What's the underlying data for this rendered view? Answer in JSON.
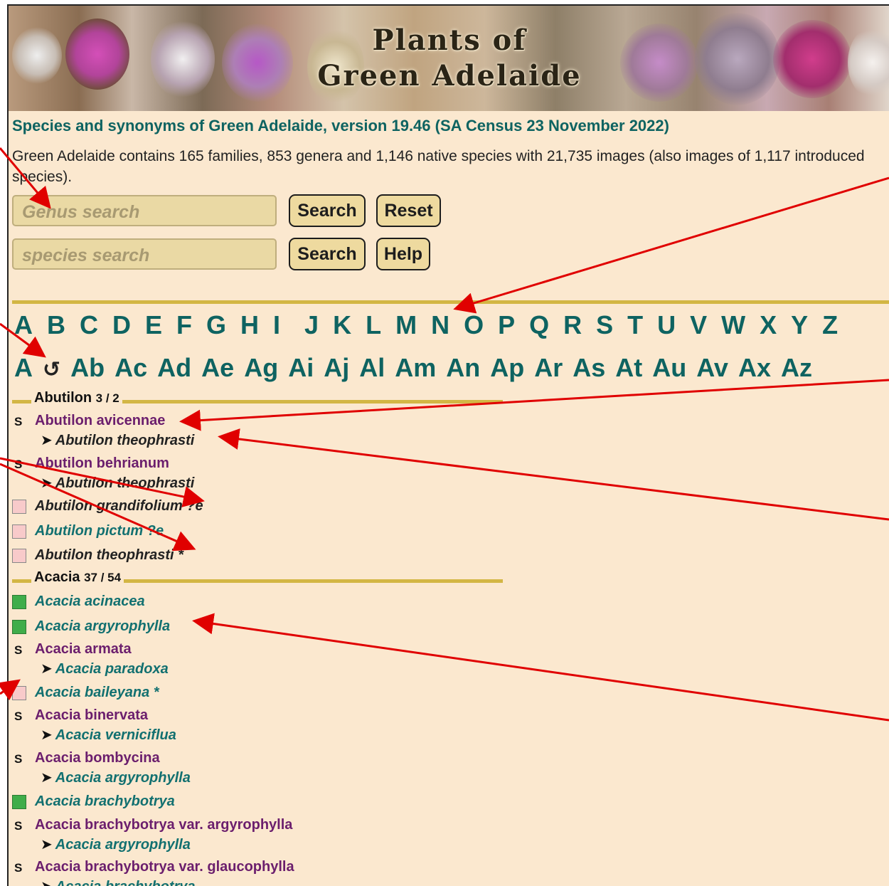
{
  "banner": {
    "title_line1": "Plants of",
    "title_line2": "Green Adelaide"
  },
  "heading": "Species and synonyms of Green Adelaide, version 19.46 (SA Census 23 November 2022)",
  "summary": "Green Adelaide contains 165 families, 853 genera and 1,146 native species with 21,735 images (also images of 1,117 introduced species).",
  "search": {
    "genus_placeholder": "Genus search",
    "species_placeholder": "species search",
    "search_label": "Search",
    "reset_label": "Reset",
    "help_label": "Help"
  },
  "alphabet": [
    "A",
    "B",
    "C",
    "D",
    "E",
    "F",
    "G",
    "H",
    "I",
    "J",
    "K",
    "L",
    "M",
    "N",
    "O",
    "P",
    "Q",
    "R",
    "S",
    "T",
    "U",
    "V",
    "W",
    "X",
    "Y",
    "Z"
  ],
  "sub_alphabet": {
    "first": "A",
    "back_icon": "↺",
    "items": [
      "Ab",
      "Ac",
      "Ad",
      "Ae",
      "Ag",
      "Ai",
      "Aj",
      "Al",
      "Am",
      "An",
      "Ap",
      "Ar",
      "As",
      "At",
      "Au",
      "Av",
      "Ax",
      "Az"
    ]
  },
  "groups": [
    {
      "genus": "Abutilon",
      "count": "3 / 2",
      "entries": [
        {
          "mark": "S",
          "name": "Abutilon avicennae",
          "ref": "Abutilon theophrasti"
        },
        {
          "mark": "S",
          "name": "Abutilon behrianum",
          "ref": "Abutilon theophrasti"
        },
        {
          "mark": "",
          "name": "Abutilon grandifolium ?e"
        },
        {
          "mark": "",
          "name": "Abutilon pictum ?e"
        },
        {
          "mark": "",
          "name": "Abutilon theophrasti *"
        }
      ]
    },
    {
      "genus": "Acacia",
      "count": "37 / 54",
      "entries": [
        {
          "mark": "",
          "name": "Acacia acinacea"
        },
        {
          "mark": "",
          "name": "Acacia argyrophylla"
        },
        {
          "mark": "S",
          "name": "Acacia armata",
          "ref": "Acacia paradoxa"
        },
        {
          "mark": "",
          "name": "Acacia baileyana *"
        },
        {
          "mark": "S",
          "name": "Acacia binervata",
          "ref": "Acacia verniciflua"
        },
        {
          "mark": "S",
          "name": "Acacia bombycina",
          "ref": "Acacia argyrophylla"
        },
        {
          "mark": "",
          "name": "Acacia brachybotrya"
        },
        {
          "mark": "S",
          "name": "Acacia brachybotrya var. argyrophylla",
          "ref": "Acacia argyrophylla"
        },
        {
          "mark": "S",
          "name": "Acacia brachybotrya var. glaucophylla",
          "ref": "Acacia brachybotrya"
        }
      ]
    }
  ],
  "colors": {
    "background": "#fbe8cf",
    "teal": "#0e6361",
    "synonym": "#6b1e6d",
    "rule": "#d3b644",
    "annotation": "#e00000",
    "native_box": "#3fad4a",
    "introduced_box": "#f8caca"
  }
}
